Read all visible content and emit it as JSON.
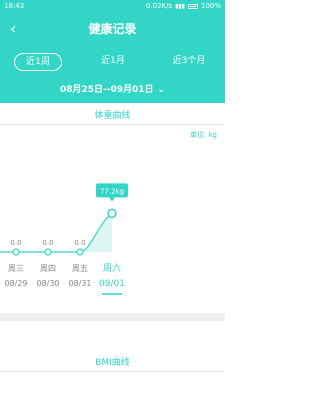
{
  "status_bar": {
    "time": "18:43",
    "net_speed": "0.02K/s",
    "battery_pct": "100%"
  },
  "header": {
    "back_icon": "chevron-left",
    "title": "健康记录"
  },
  "tabs": [
    {
      "label": "近1周",
      "active": true
    },
    {
      "label": "近1月",
      "active": false
    },
    {
      "label": "近3个月",
      "active": false
    }
  ],
  "date_range": {
    "label": "08月25日--09月01日",
    "caret_icon": "chevron-down"
  },
  "weight_section": {
    "title": "体重曲线",
    "unit": "单位: kg",
    "tooltip": "77.2kg",
    "points": [
      {
        "weekday": "周三",
        "date": "08/29",
        "value": 0.0,
        "label": "0.0"
      },
      {
        "weekday": "周四",
        "date": "08/30",
        "value": 0.0,
        "label": "0.0"
      },
      {
        "weekday": "周五",
        "date": "08/31",
        "value": 0.0,
        "label": "0.0"
      },
      {
        "weekday": "周六",
        "date": "09/01",
        "value": 77.2,
        "label": "77.2kg",
        "selected": true
      }
    ]
  },
  "bmi_section": {
    "title": "BMI曲线"
  },
  "colors": {
    "accent": "#33d6c6",
    "text_gray": "#888888"
  }
}
